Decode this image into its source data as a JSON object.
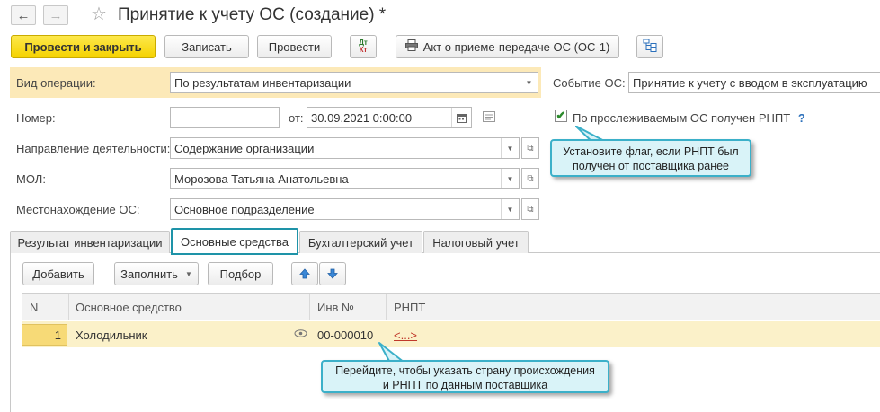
{
  "window": {
    "title": "Принятие к учету ОС (создание) *",
    "nav_back_icon": "←",
    "nav_forward_icon": "→",
    "favorite_icon": "☆"
  },
  "toolbar": {
    "post_close": "Провести и закрыть",
    "save": "Записать",
    "post": "Провести",
    "dtkt_dt": "Дт",
    "dtkt_kt": "Кт",
    "act": "Акт о приеме-передаче ОС (ОС-1)"
  },
  "form": {
    "operation_label": "Вид операции:",
    "operation_value": "По результатам инвентаризации",
    "event_label": "Событие ОС:",
    "event_value": "Принятие к учету с вводом в эксплуатацию",
    "number_label": "Номер:",
    "number_value": "",
    "date_label": "от:",
    "date_value": "30.09.2021  0:00:00",
    "rnpt_checkbox_label": "По прослеживаемым ОС получен РНПТ",
    "rnpt_checked": true,
    "help": "?",
    "direction_label": "Направление деятельности:",
    "direction_value": "Содержание организации",
    "mol_label": "МОЛ:",
    "mol_value": "Морозова Татьяна Анатольевна",
    "location_label": "Местонахождение ОС:",
    "location_value": "Основное подразделение"
  },
  "tooltips": {
    "flag_line1": "Установите флаг, если РНПТ был",
    "flag_line2": "получен от поставщика ранее",
    "rnpt_line1": "Перейдите, чтобы указать страну происхождения",
    "rnpt_line2": "и РНПТ по данным поставщика"
  },
  "tabs": [
    {
      "label": "Результат инвентаризации",
      "active": false
    },
    {
      "label": "Основные средства",
      "active": true
    },
    {
      "label": "Бухгалтерский учет",
      "active": false
    },
    {
      "label": "Налоговый учет",
      "active": false
    }
  ],
  "table_toolbar": {
    "add": "Добавить",
    "fill": "Заполнить",
    "select": "Подбор"
  },
  "table": {
    "columns": [
      "N",
      "Основное средство",
      "Инв №",
      "РНПТ"
    ],
    "rows": [
      {
        "n": "1",
        "asset": "Холодильник",
        "inv": "00-000010",
        "rnpt": "<...>"
      }
    ]
  },
  "colors": {
    "primary_button": "#f5d200",
    "operation_band": "#fce9b8",
    "active_tab_border": "#1e93a8",
    "tooltip_bg": "#d9f3f8",
    "row_highlight": "#fbf1c9",
    "link": "#c0392b"
  }
}
